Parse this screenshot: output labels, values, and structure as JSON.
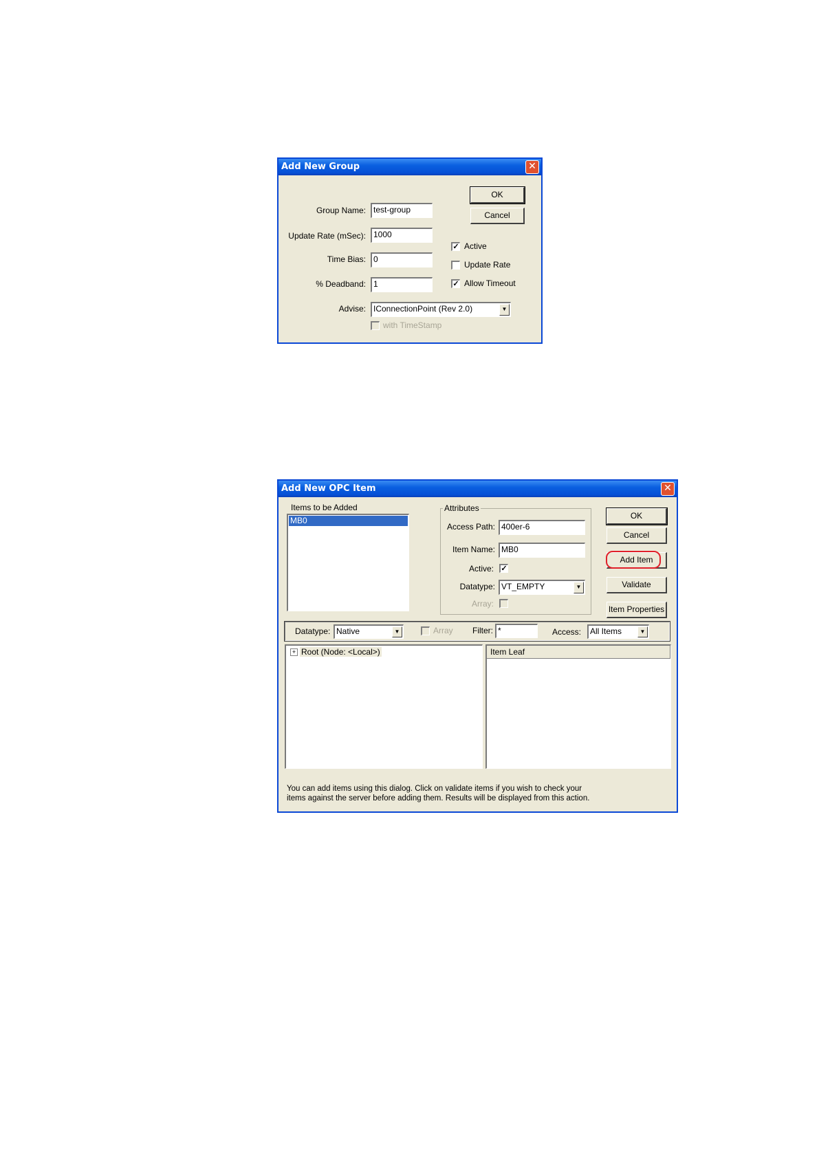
{
  "dialog1": {
    "title": "Add New Group",
    "close_glyph": "✕",
    "labels": {
      "group_name": "Group Name:",
      "update_rate": "Update Rate (mSec):",
      "time_bias": "Time Bias:",
      "deadband": "% Deadband:",
      "advise": "Advise:"
    },
    "values": {
      "group_name": "test-group",
      "update_rate": "1000",
      "time_bias": "0",
      "deadband": "1",
      "advise": "IConnectionPoint (Rev 2.0)"
    },
    "buttons": {
      "ok": "OK",
      "cancel": "Cancel"
    },
    "checks": {
      "active": {
        "label": "Active",
        "checked": "✓"
      },
      "update_rate": {
        "label": "Update Rate",
        "checked": ""
      },
      "allow_timeout": {
        "label": "Allow Timeout",
        "checked": "✓"
      },
      "with_timestamp": {
        "label": "with TimeStamp",
        "checked": ""
      }
    }
  },
  "dialog2": {
    "title": "Add New OPC Item",
    "close_glyph": "✕",
    "items_to_add": {
      "label": "Items to be Added",
      "items": [
        "MB0"
      ]
    },
    "attributes": {
      "title": "Attributes",
      "access_path_label": "Access Path:",
      "access_path_value": "400er-6",
      "item_name_label": "Item Name:",
      "item_name_value": "MB0",
      "active_label": "Active:",
      "active_checked": "✓",
      "datatype_label": "Datatype:",
      "datatype_value": "VT_EMPTY",
      "array_label": "Array:"
    },
    "buttons": {
      "ok": "OK",
      "cancel": "Cancel",
      "add_item": "Add Item",
      "validate": "Validate",
      "item_properties": "Item Properties"
    },
    "filter_bar": {
      "datatype_label": "Datatype:",
      "datatype_value": "Native",
      "array_label": "Array",
      "filter_label": "Filter:",
      "filter_value": "*",
      "access_label": "Access:",
      "access_value": "All Items"
    },
    "tree": {
      "root": "Root (Node: <Local>)",
      "expander": "+"
    },
    "leaf": {
      "header": "Item Leaf"
    },
    "help_text_1": "You can add items using this dialog.  Click on validate items if you wish to check your",
    "help_text_2": "items against the server before adding them.  Results will be displayed from this action.",
    "highlight_color": "#e0202a"
  }
}
